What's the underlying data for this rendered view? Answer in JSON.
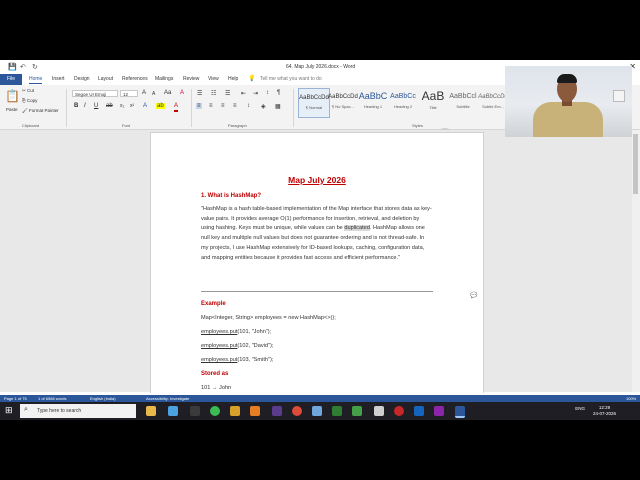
{
  "window": {
    "title": "64. Map July 2026.docx - Word",
    "close_glyph": "✕"
  },
  "quick_access": {
    "save": "💾",
    "undo": "↶",
    "redo": "↻"
  },
  "tabs": [
    "File",
    "Home",
    "Insert",
    "Design",
    "Layout",
    "References",
    "Mailings",
    "Review",
    "View",
    "Help"
  ],
  "tell_me": "Tell me what you want to do",
  "ribbon": {
    "clipboard": {
      "paste": "Paste",
      "cut": "Cut",
      "copy": "Copy",
      "format_painter": "Format Painter",
      "label": "Clipboard"
    },
    "font": {
      "family": "Segoe UI Emoji",
      "size": "12",
      "label": "Font"
    },
    "paragraph": {
      "label": "Paragraph"
    },
    "styles": {
      "items": [
        {
          "preview": "AaBbCcDd",
          "name": "¶ Normal"
        },
        {
          "preview": "AaBbCcDd",
          "name": "¶ No Spac..."
        },
        {
          "preview": "AaBbC",
          "name": "Heading 1"
        },
        {
          "preview": "AaBbCc",
          "name": "Heading 2"
        },
        {
          "preview": "AaB",
          "name": "Title"
        },
        {
          "preview": "AaBbCcl",
          "name": "Subtitle"
        },
        {
          "preview": "AaBbCcDd",
          "name": "Subtle Em..."
        }
      ],
      "label": "Styles"
    }
  },
  "document": {
    "heading": "Map July 2026",
    "section1": "1. What is HashMap?",
    "para_before": "\"HashMap is a hash table-based implementation of the Map interface that stores data as key-value pairs. It provides average O(1) performance for insertion, retrieval, and deletion by using hashing. Keys must be unique, while values can be ",
    "para_highlight": "duplicated",
    "para_after": ". HashMap allows one null key and multiple null values but does not guarantee ordering and is not thread-safe. In my projects, I use HashMap extensively for ID-based lookups, caching, configuration data, and mapping entities because it provides fast access and efficient performance.\"",
    "example": "Example",
    "code_decl": "Map<Integer, String> employees = new HashMap<>();",
    "put1_obj": "employees.put",
    "put1_args": "(101, \"John\");",
    "put2_obj": "employees.put",
    "put2_args": "(102, \"David\");",
    "put3_obj": "employees.put",
    "put3_args": "(103, \"Smith\");",
    "stored_as": "Stored as",
    "stored_line": "101 → John"
  },
  "statusbar": {
    "page": "Page 1 of 75",
    "words": "1 of 6586 words",
    "language": "English (India)",
    "accessibility": "Accessibility: Investigate",
    "zoom": "100%"
  },
  "taskbar": {
    "search_placeholder": "Type here to search",
    "tray": "ENG",
    "time": "12:29",
    "date": "24-07-2026"
  },
  "colors": {
    "word_blue": "#2b579a",
    "heading_red": "#c00000"
  }
}
